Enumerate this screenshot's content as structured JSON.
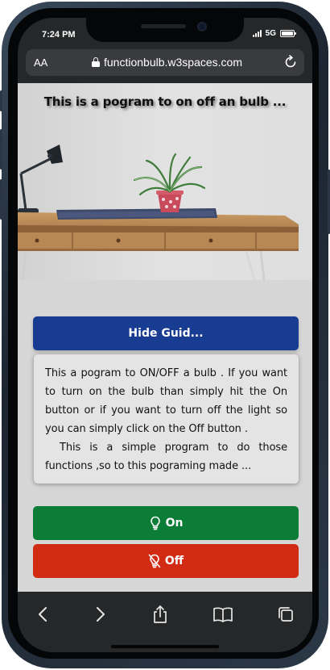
{
  "status_bar": {
    "time": "7:24 PM",
    "network": "5G"
  },
  "browser": {
    "text_size_label": "AA",
    "url": "functionbulb.w3spaces.com",
    "lock_icon": "lock-icon",
    "reload_icon": "reload-icon"
  },
  "page": {
    "hero_title": "This is a pogram to on off an bulb ...",
    "guide_button_label": "Hide Guid...",
    "guide_paragraphs": [
      "This a pogram to ON/OFF a bulb . If you want to turn on the bulb than simply hit the On button or if you want to turn off the light so you can simply click on the Off button .",
      "This is a simple program to do those functions ,so to this pograming made ..."
    ],
    "on_label": "On",
    "off_label": "Off",
    "on_icon": "lightbulb-icon",
    "off_icon": "lightbulb-slash-icon",
    "colors": {
      "guide_button": "#173c91",
      "on_button": "#0b7d36",
      "off_button": "#d12c13"
    }
  },
  "toolbar": {
    "items": [
      "back-icon",
      "forward-icon",
      "share-icon",
      "bookmarks-icon",
      "tabs-icon"
    ]
  }
}
